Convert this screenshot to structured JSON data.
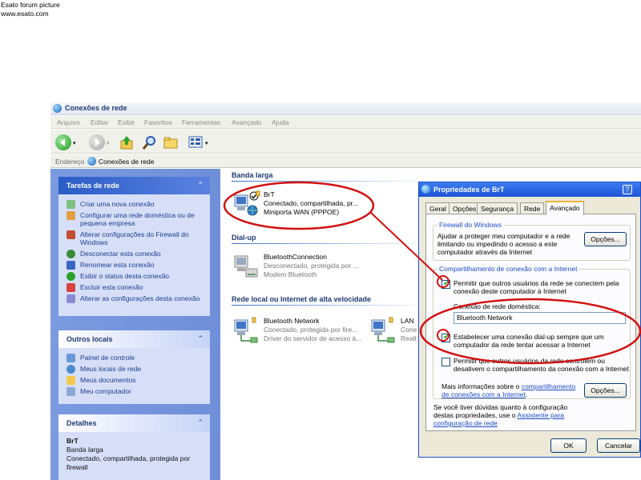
{
  "watermark": {
    "line1": "Esato forum picture",
    "line2": "www.esato.com"
  },
  "window": {
    "title": "Conexões de rede"
  },
  "menu": [
    "Arquivo",
    "Editar",
    "Exibir",
    "Favoritos",
    "Ferramentas",
    "Avançado",
    "Ajuda"
  ],
  "address": {
    "label": "Endereço",
    "value": "Conexões de rede"
  },
  "tasks": {
    "title": "Tarefas de rede",
    "items": [
      "Criar uma nova conexão",
      "Configurar uma rede doméstica ou de pequena empresa",
      "Alterar configurações do Firewall do Windows",
      "Desconectar esta conexão",
      "Renomear esta conexão",
      "Exibir o status desta conexão",
      "Excluir esta conexão",
      "Alterar as configurações desta conexão"
    ]
  },
  "other_places": {
    "title": "Outros locais",
    "items": [
      "Painel de controle",
      "Meus locais de rede",
      "Meus documentos",
      "Meu computador"
    ]
  },
  "details": {
    "title": "Detalhes",
    "name": "BrT",
    "type": "Banda larga",
    "status_line1": "Conectado, compartilhada, protegida por",
    "status_line2": "firewall"
  },
  "groups": {
    "broadband": "Banda larga",
    "dialup": "Dial-up",
    "lan": "Rede local ou Internet de alta velocidade"
  },
  "connections": {
    "brt": {
      "name": "BrT",
      "status": "Conectado, compartilhada, pr...",
      "device": "Miniporta WAN (PPPOE)"
    },
    "bluetooth_conn": {
      "name": "BluetoothConnection",
      "status": "Desconectado, protegida por ...",
      "device": "Modem Bluetooth"
    },
    "bluetooth_net": {
      "name": "Bluetooth Network",
      "status": "Conectado, protegida por fire...",
      "device": "Driver do servidor de acesso à..."
    },
    "lan": {
      "name": "LAN",
      "status": "Cone",
      "device": "Realt"
    }
  },
  "dialog": {
    "title": "Propriedades de BrT",
    "help": "?",
    "tabs": [
      "Geral",
      "Opções",
      "Segurança",
      "Rede",
      "Avançado"
    ],
    "firewall": {
      "legend": "Firewall do Windows",
      "line1": "Ajudar a proteger meu computador e a rede",
      "line2": "limitando ou impedindo o acesso a este",
      "line3": "computador através da Internet",
      "button": "Opções..."
    },
    "ics": {
      "legend": "Compartilhamento de conexão com a Internet",
      "allow_line1": "Permitir que outros usuários da rede se conectem pela",
      "allow_line2": "conexão deste computador à Internet",
      "home_label": "Conexão de rede doméstica:",
      "home_value": "Bluetooth Network",
      "dial_line1": "Estabelecer uma conexão dial-up sempre que um",
      "dial_line2": "computador da rede tentar acessar a Internet",
      "control_line1": "Permitir que outros usuários da rede controlem ou",
      "control_line2": "desativem o compartilhamento da conexão com a Internet",
      "more_prefix": "Mais informações sobre o ",
      "more_link1": "compartilhamento",
      "more_link2": "de conexões com a Internet",
      "more_suffix": ".",
      "button": "Opções..."
    },
    "footer": {
      "line1": "Se você tiver dúvidas quanto à configuração",
      "line2_prefix": "destas propriedades, use o ",
      "line2_link": "Assistente para",
      "line3_link": "configuração de rede"
    },
    "ok": "OK",
    "cancel": "Cancelar"
  },
  "colors": {
    "task_pane": "#6f8fd8",
    "dialog_title": "#1d55d6",
    "annotation": "#d21010"
  }
}
